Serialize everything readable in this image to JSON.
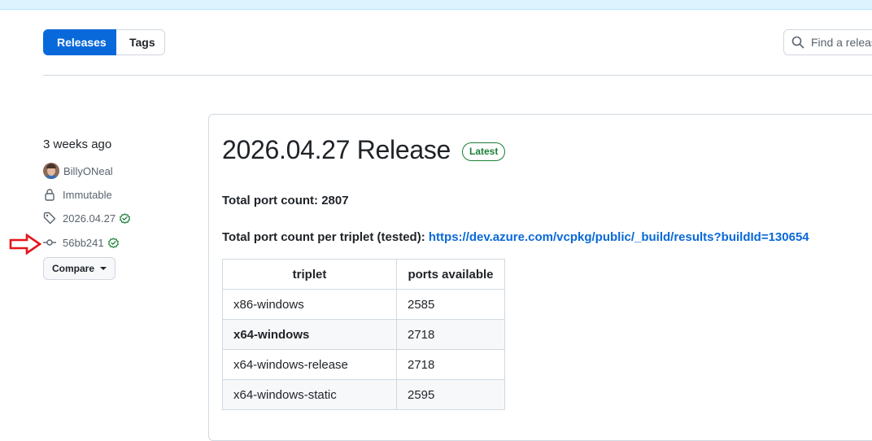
{
  "tabs": {
    "releases": "Releases",
    "tags": "Tags"
  },
  "search": {
    "placeholder": "Find a release"
  },
  "sidebar": {
    "date": "3 weeks ago",
    "author": "BillyONeal",
    "immutable": "Immutable",
    "tag": "2026.04.27",
    "commit": "56bb241",
    "compare": "Compare"
  },
  "release": {
    "title": "2026.04.27 Release",
    "badge": "Latest",
    "port_count": "Total port count: 2807",
    "per_triplet_label": "Total port count per triplet (tested):",
    "per_triplet_link": "https://dev.azure.com/vcpkg/public/_build/results?buildId=130654",
    "table": {
      "headers": [
        "triplet",
        "ports available"
      ],
      "rows": [
        [
          "x86-windows",
          "2585"
        ],
        [
          "x64-windows",
          "2718"
        ],
        [
          "x64-windows-release",
          "2718"
        ],
        [
          "x64-windows-static",
          "2595"
        ]
      ]
    }
  },
  "colors": {
    "accent": "#0969da",
    "success": "#1a7f37",
    "annotation": "#e5141b"
  }
}
